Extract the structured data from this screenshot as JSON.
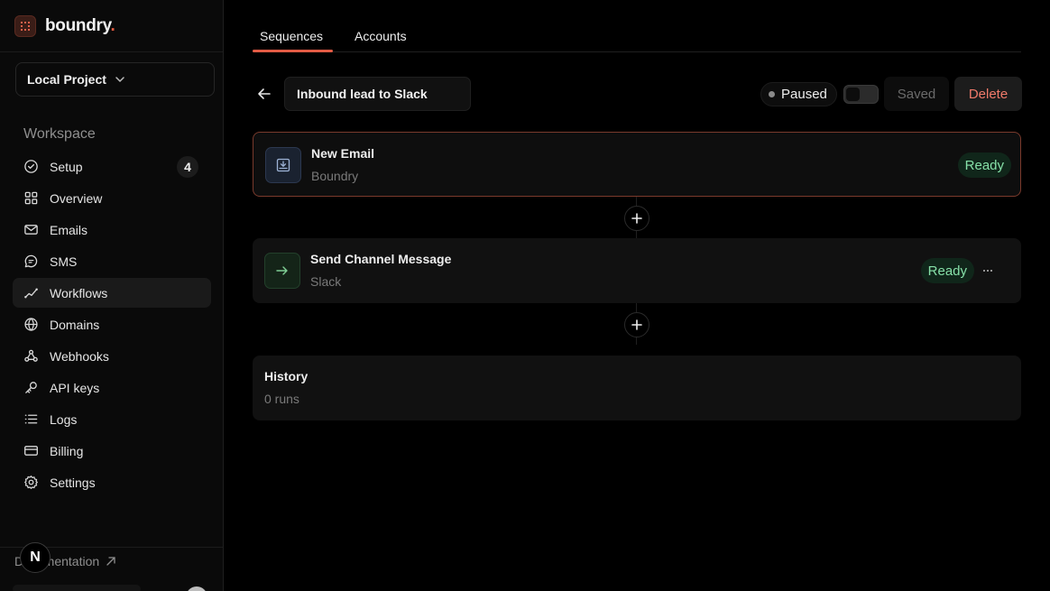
{
  "brand": {
    "name": "boundry",
    "dot": "."
  },
  "project": {
    "selected": "Local Project"
  },
  "sidebar": {
    "section_label": "Workspace",
    "items": [
      {
        "label": "Setup",
        "icon": "check-circle-icon",
        "badge": "4"
      },
      {
        "label": "Overview",
        "icon": "grid-icon"
      },
      {
        "label": "Emails",
        "icon": "mail-icon"
      },
      {
        "label": "SMS",
        "icon": "chat-icon"
      },
      {
        "label": "Workflows",
        "icon": "workflow-icon",
        "active": true
      },
      {
        "label": "Domains",
        "icon": "globe-icon"
      },
      {
        "label": "Webhooks",
        "icon": "webhook-icon"
      },
      {
        "label": "API keys",
        "icon": "key-icon"
      },
      {
        "label": "Logs",
        "icon": "list-icon"
      },
      {
        "label": "Billing",
        "icon": "card-icon"
      },
      {
        "label": "Settings",
        "icon": "gear-icon"
      }
    ],
    "docs_label": "Documentation",
    "n_badge": "N"
  },
  "tabs": [
    {
      "label": "Sequences",
      "active": true
    },
    {
      "label": "Accounts"
    }
  ],
  "workflow": {
    "name": "Inbound lead to Slack",
    "status": "Paused",
    "saved_label": "Saved",
    "delete_label": "Delete"
  },
  "steps": [
    {
      "title": "New Email",
      "subtitle": "Boundry",
      "status": "Ready",
      "icon": "inbox-download-icon"
    },
    {
      "title": "Send Channel Message",
      "subtitle": "Slack",
      "status": "Ready",
      "icon": "arrow-right-icon"
    }
  ],
  "history": {
    "title": "History",
    "runs": "0 runs"
  },
  "colors": {
    "accent": "#e35b45",
    "ready_text": "#86e0a8",
    "delete_text": "#f07a6a"
  }
}
